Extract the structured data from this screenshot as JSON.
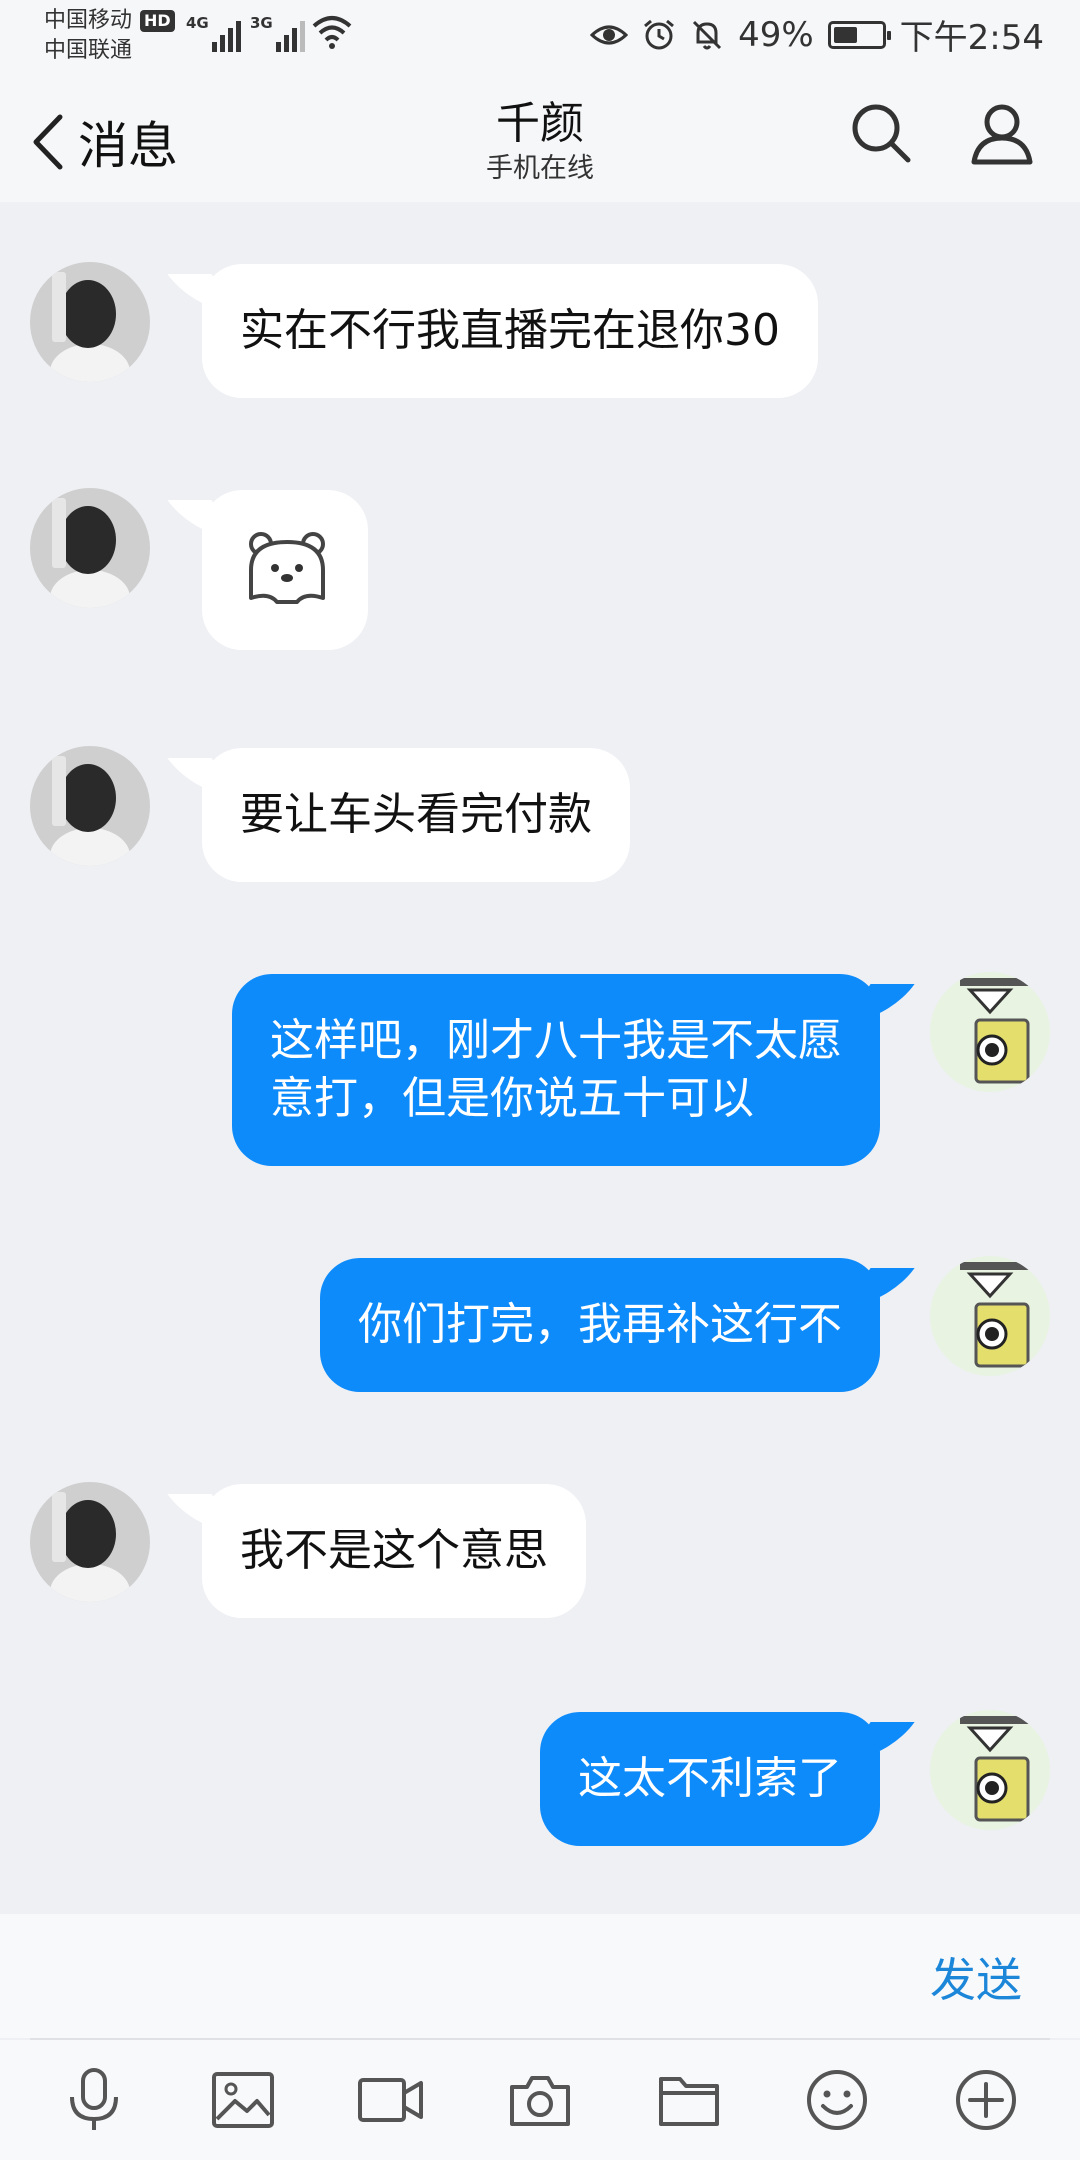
{
  "status_bar": {
    "carrier_1": "中国移动",
    "carrier_2": "中国联通",
    "hd_badge": "HD",
    "network_1": "4G",
    "network_2": "3G",
    "battery_percent": "49%",
    "battery_level": 0.49,
    "time": "下午2:54"
  },
  "header": {
    "back_label": "消息",
    "contact_name": "千颜",
    "contact_status": "手机在线"
  },
  "messages": [
    {
      "side": "in",
      "text": "实在不行我直播完在退你30"
    },
    {
      "side": "in",
      "sticker": "bear-sticker"
    },
    {
      "side": "in",
      "text": "要让车头看完付款"
    },
    {
      "side": "out",
      "text_line_1": "这样吧，刚才八十我是不太愿",
      "text_line_2": "意打，但是你说五十可以"
    },
    {
      "side": "out",
      "text": "你们打完，我再补这行不"
    },
    {
      "side": "in",
      "text": "我不是这个意思"
    },
    {
      "side": "out",
      "text": "这太不利索了"
    }
  ],
  "input": {
    "send_label": "发送"
  },
  "toolbar": {
    "icons": [
      "microphone-icon",
      "image-icon",
      "video-icon",
      "camera-icon",
      "folder-icon",
      "emoji-icon",
      "plus-icon"
    ]
  },
  "colors": {
    "outgoing_bubble": "#0d8bfa",
    "incoming_bubble": "#ffffff",
    "background": "#eef0f4",
    "send_text": "#1c87d9"
  }
}
